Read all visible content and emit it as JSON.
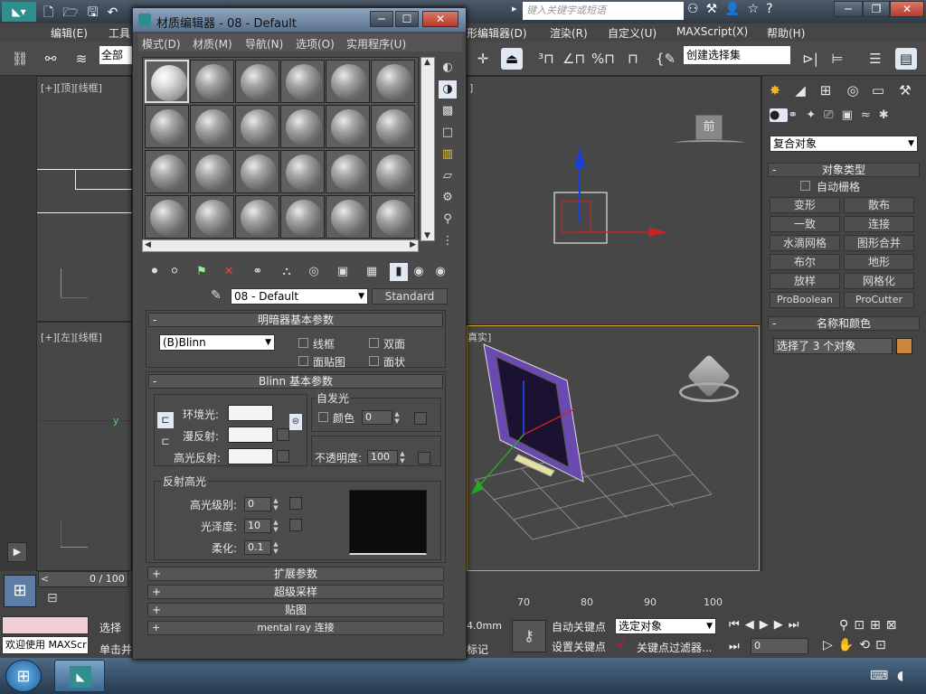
{
  "app": {
    "menu": [
      "编辑(E)",
      "工具",
      "形编辑器(D)",
      "渲染(R)",
      "自定义(U)",
      "MAXScript(X)",
      "帮助(H)"
    ],
    "search_placeholder": "键入关键字或短语",
    "selection_filter": "全部",
    "named_selection": "创建选择集"
  },
  "viewports": {
    "top_label": "[+][顶][线框]",
    "left_label": "[+][左][线框]",
    "persp_label_partial": "真实]",
    "front_label_partial": "]",
    "viewcube_front": "前"
  },
  "cmdpanel": {
    "dropdown": "复合对象",
    "object_type_title": "对象类型",
    "auto_grid": "自动栅格",
    "buttons": [
      "变形",
      "散布",
      "一致",
      "连接",
      "水滴网格",
      "图形合并",
      "布尔",
      "地形",
      "放样",
      "网格化",
      "ProBoolean",
      "ProCutter"
    ],
    "name_color_title": "名称和颜色",
    "selected_text": "选择了 3 个对象",
    "color": "#c8873c"
  },
  "bottom": {
    "timeline_counter": "0 / 100",
    "ruler_ticks": [
      "70",
      "80",
      "90",
      "100"
    ],
    "coord_value": "4.0mm",
    "select_label": "选择",
    "single_label": "单击并",
    "maxscript_text": "欢迎使用 MAXScr",
    "addtime_label": "标记",
    "auto_key": "自动关键点",
    "set_key": "设置关键点",
    "selected_object": "选定对象",
    "key_filters": "关键点过滤器...",
    "frame_value": "0"
  },
  "material_editor": {
    "title": "材质编辑器 - 08 - Default",
    "menu": [
      "模式(D)",
      "材质(M)",
      "导航(N)",
      "选项(O)",
      "实用程序(U)"
    ],
    "material_name": "08 - Default",
    "material_type": "Standard",
    "shader_rollout": {
      "title": "明暗器基本参数",
      "shader": "(B)Blinn",
      "wire": "线框",
      "two_sided": "双面",
      "face_map": "面贴图",
      "faceted": "面状"
    },
    "blinn_rollout": {
      "title": "Blinn 基本参数",
      "self_illum": "自发光",
      "color_label": "颜色",
      "self_illum_value": "0",
      "ambient": "环境光:",
      "diffuse": "漫反射:",
      "specular": "高光反射:",
      "opacity_label": "不透明度:",
      "opacity_value": "100",
      "spec_highlights": "反射高光",
      "spec_level": "高光级别:",
      "spec_level_value": "0",
      "glossiness": "光泽度:",
      "glossiness_value": "10",
      "soften": "柔化:",
      "soften_value": "0.1"
    },
    "rollouts": [
      "扩展参数",
      "超级采样",
      "贴图",
      "mental ray 连接"
    ]
  }
}
